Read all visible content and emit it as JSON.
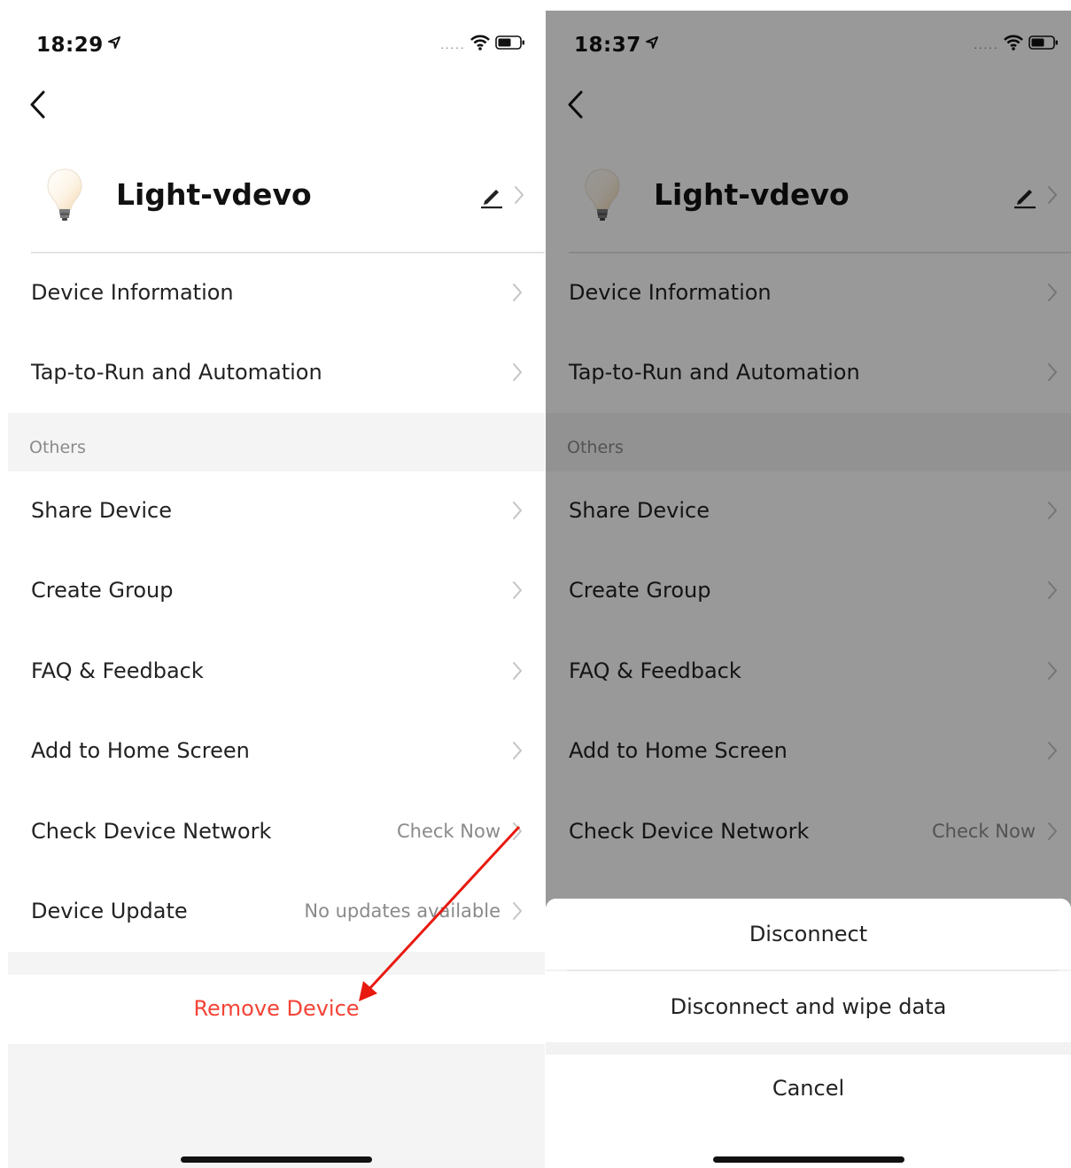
{
  "left": {
    "status": {
      "time": "18:29"
    },
    "device_name": "Light-vdevo",
    "rows_top": [
      {
        "label": "Device Information"
      },
      {
        "label": "Tap-to-Run and Automation"
      }
    ],
    "section_title": "Others",
    "rows_others": [
      {
        "label": "Share Device"
      },
      {
        "label": "Create Group"
      },
      {
        "label": "FAQ & Feedback"
      },
      {
        "label": "Add to Home Screen"
      },
      {
        "label": "Check Device Network",
        "value": "Check Now"
      },
      {
        "label": "Device Update",
        "value": "No updates available"
      }
    ],
    "remove_label": "Remove Device"
  },
  "right": {
    "status": {
      "time": "18:37"
    },
    "device_name": "Light-vdevo",
    "rows_top": [
      {
        "label": "Device Information"
      },
      {
        "label": "Tap-to-Run and Automation"
      }
    ],
    "section_title": "Others",
    "rows_others": [
      {
        "label": "Share Device"
      },
      {
        "label": "Create Group"
      },
      {
        "label": "FAQ & Feedback"
      },
      {
        "label": "Add to Home Screen"
      },
      {
        "label": "Check Device Network",
        "value": "Check Now"
      }
    ],
    "action_sheet": {
      "options": [
        "Disconnect",
        "Disconnect and wipe data"
      ],
      "cancel": "Cancel"
    }
  },
  "colors": {
    "danger": "#f44336",
    "annotation_arrow": "#e8190f",
    "overlay": "rgba(0,0,0,0.40)"
  },
  "icons": [
    "location-arrow-icon",
    "signal-dots-icon",
    "wifi-icon",
    "battery-icon",
    "back-chevron-icon",
    "light-bulb-icon",
    "edit-pencil-icon",
    "chevron-right-icon"
  ]
}
